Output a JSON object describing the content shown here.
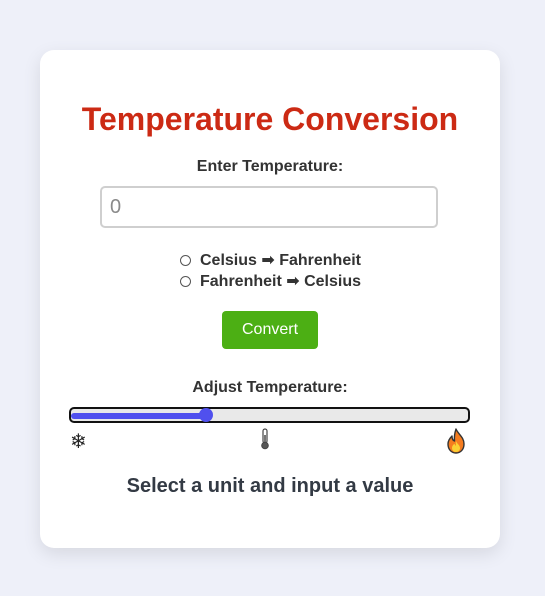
{
  "header": {
    "title": "Temperature Conversion"
  },
  "input": {
    "label": "Enter Temperature:",
    "value": "",
    "placeholder": "0"
  },
  "conversion_options": [
    {
      "label": "Celsius ➡ Fahrenheit",
      "selected": false
    },
    {
      "label": "Fahrenheit ➡ Celsius",
      "selected": false
    }
  ],
  "convert_button": {
    "label": "Convert"
  },
  "slider": {
    "label": "Adjust Temperature:",
    "fraction": 0.34,
    "icons": [
      "snowflake-icon",
      "thermometer-icon",
      "fire-icon"
    ]
  },
  "result": {
    "text": "Select a unit and input a value"
  },
  "colors": {
    "title": "#cc2a14",
    "button": "#4caf14",
    "slider_accent": "#5050ee",
    "background": "#eef0f9"
  }
}
